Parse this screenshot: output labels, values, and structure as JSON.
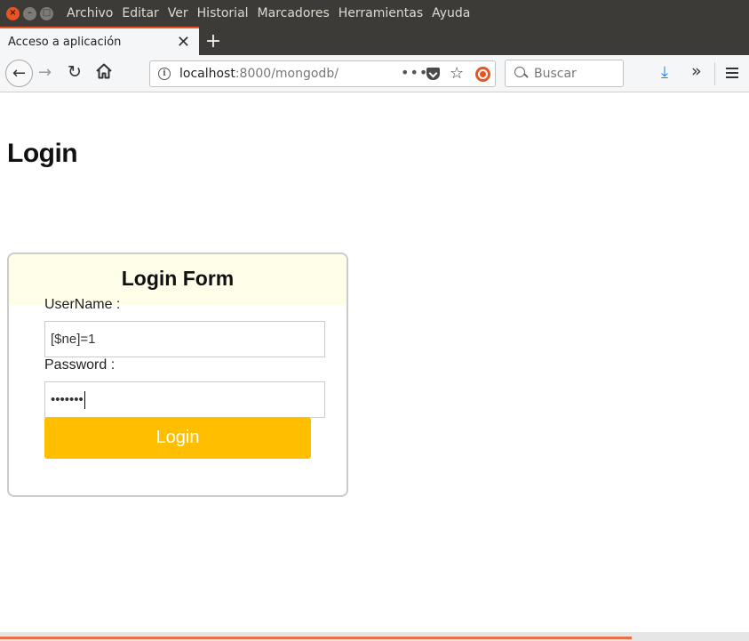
{
  "window": {
    "controls": [
      "close-icon",
      "minimize-icon",
      "maximize-icon"
    ],
    "menu": [
      "Archivo",
      "Editar",
      "Ver",
      "Historial",
      "Marcadores",
      "Herramientas",
      "Ayuda"
    ]
  },
  "tab": {
    "title": "Acceso a aplicación",
    "close_glyph": "✕",
    "new_tab_glyph": "+"
  },
  "address_bar": {
    "host": "localhost",
    "path": ":8000/mongodb/",
    "page_actions_glyph": "•••"
  },
  "search": {
    "placeholder": "Buscar"
  },
  "page": {
    "title": "Login",
    "form_title": "Login Form",
    "username_label": "UserName :",
    "username_value": "[$ne]=1",
    "password_label": "Password :",
    "password_value": "•••••••",
    "submit_label": "Login"
  },
  "status": {
    "page_load_progress": 0.843
  },
  "colors": {
    "accent": "#e95420",
    "button": "#ffbf00",
    "form_header_bg": "#fefee9",
    "download_icon": "#0a84ff"
  }
}
